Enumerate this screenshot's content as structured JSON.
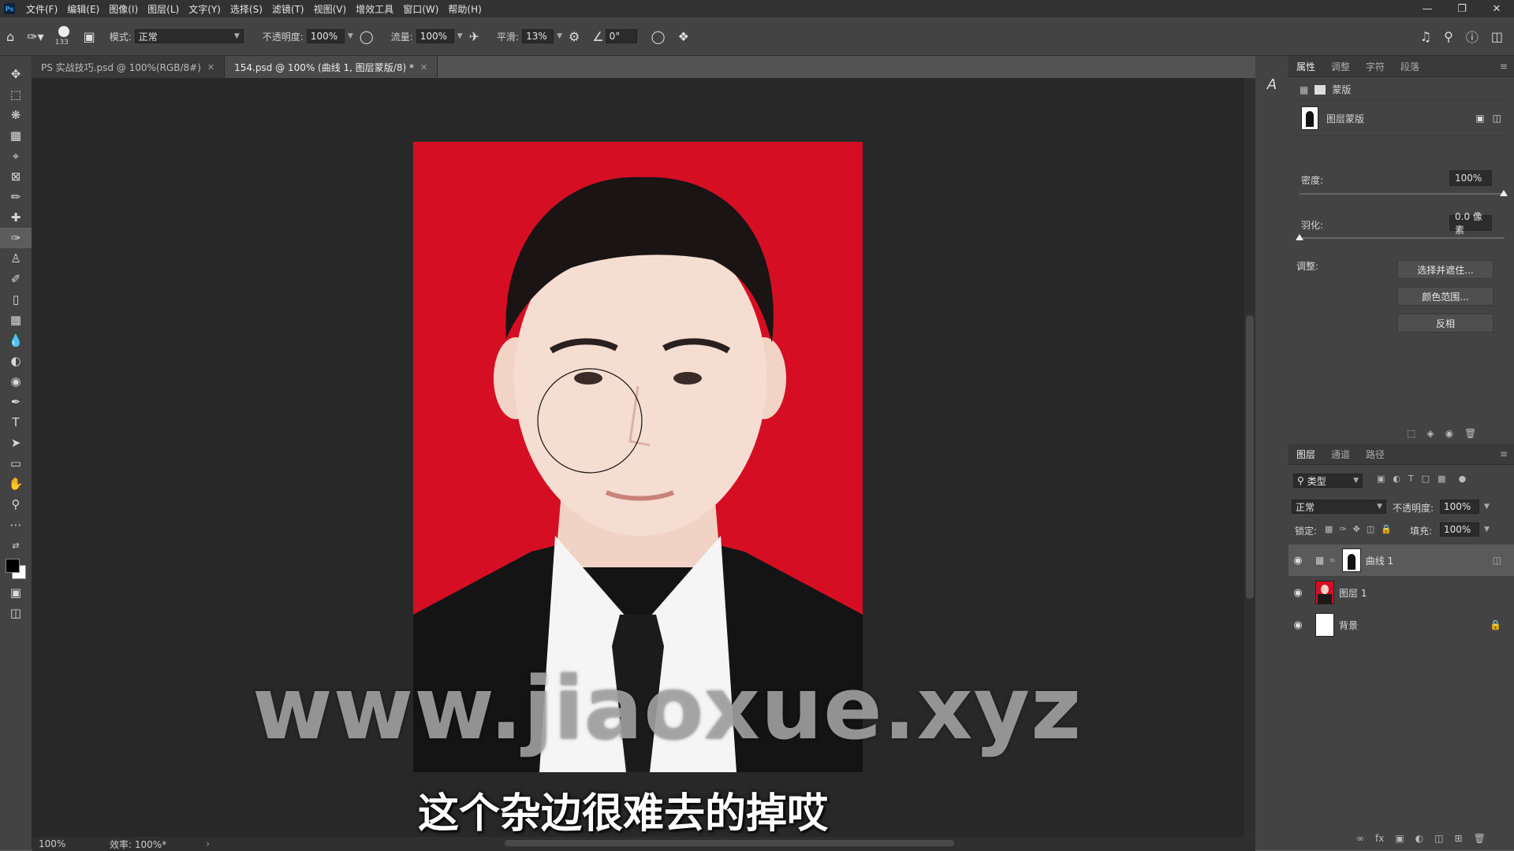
{
  "app": {
    "logo": "Ps"
  },
  "menu": [
    "文件(F)",
    "编辑(E)",
    "图像(I)",
    "图层(L)",
    "文字(Y)",
    "选择(S)",
    "滤镜(T)",
    "视图(V)",
    "增效工具",
    "窗口(W)",
    "帮助(H)"
  ],
  "options": {
    "brush_size": "133",
    "mode_label": "模式:",
    "mode_value": "正常",
    "opacity_label": "不透明度:",
    "opacity_value": "100%",
    "flow_label": "流量:",
    "flow_value": "100%",
    "smooth_label": "平滑:",
    "smooth_value": "13%",
    "angle_value": "0°"
  },
  "tabs": [
    {
      "label": "PS 实战技巧.psd @ 100%(RGB/8#)"
    },
    {
      "label": "154.psd @ 100% (曲线 1, 图层蒙版/8) *"
    }
  ],
  "canvas": {
    "watermark": "www.jiaoxue.xyz",
    "subtitle": "这个杂边很难去的掉哎",
    "background_color": "#d50e24"
  },
  "status": {
    "zoom": "100%",
    "efficiency": "效率: 100%*"
  },
  "properties": {
    "tabs": [
      "属性",
      "调整",
      "字符",
      "段落"
    ],
    "mask_label": "蒙版",
    "layer_mask_label": "图层蒙版",
    "density_label": "密度:",
    "density_value": "100%",
    "feather_label": "羽化:",
    "feather_value": "0.0 像素",
    "adjust_label": "调整:",
    "btn_select_mask": "选择并遮住...",
    "btn_color_range": "颜色范围...",
    "btn_invert": "反相"
  },
  "layers_panel": {
    "tabs": [
      "图层",
      "通道",
      "路径"
    ],
    "filter_label": "类型",
    "blend_mode": "正常",
    "opacity_label": "不透明度:",
    "opacity_value": "100%",
    "lock_label": "锁定:",
    "fill_label": "填充:",
    "fill_value": "100%",
    "layers": [
      {
        "name": "曲线 1"
      },
      {
        "name": "图层 1"
      },
      {
        "name": "背景"
      }
    ]
  }
}
